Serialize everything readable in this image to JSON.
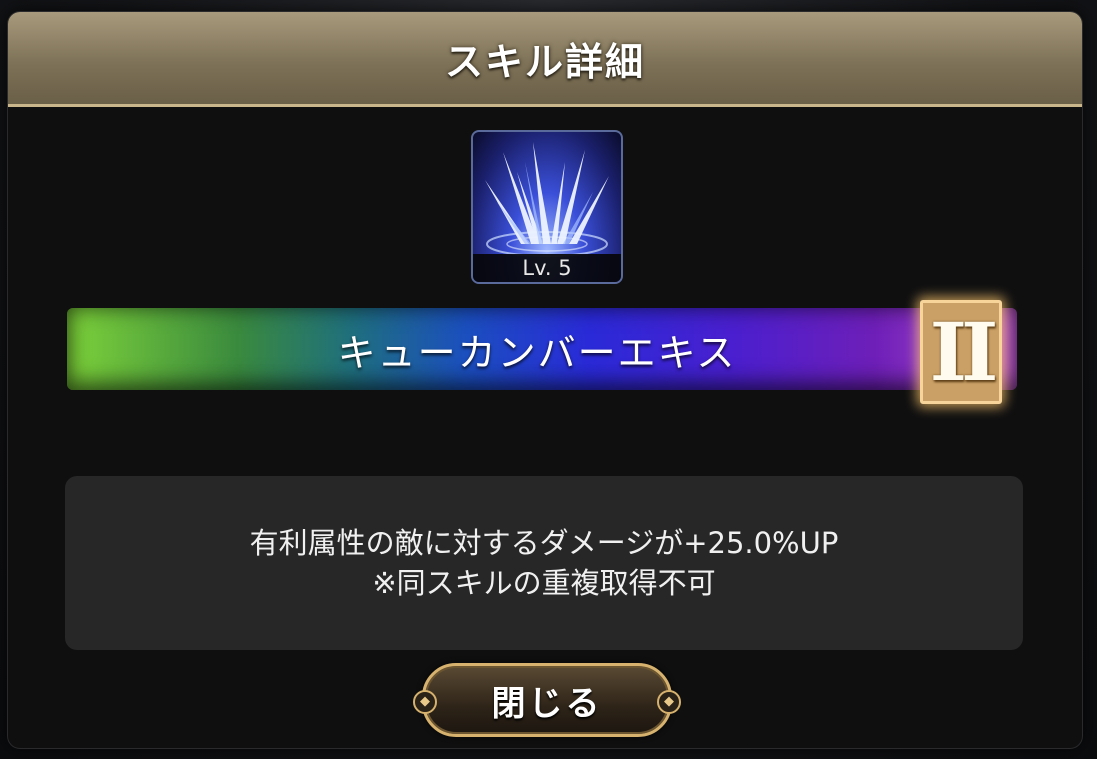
{
  "dialog": {
    "title": "スキル詳細"
  },
  "skill": {
    "icon": "ice-spikes-icon",
    "level_label": "Lv. 5",
    "name": "キューカンバーエキス",
    "grade": "II",
    "description_lines": [
      "有利属性の敵に対するダメージが+25.0%UP",
      "※同スキルの重複取得不可"
    ]
  },
  "actions": {
    "close_label": "閉じる"
  },
  "colors": {
    "header_bg": "#8a7d61",
    "accent_gold": "#d6b26e",
    "panel_bg": "#0f0f10",
    "description_bg": "#272727"
  }
}
